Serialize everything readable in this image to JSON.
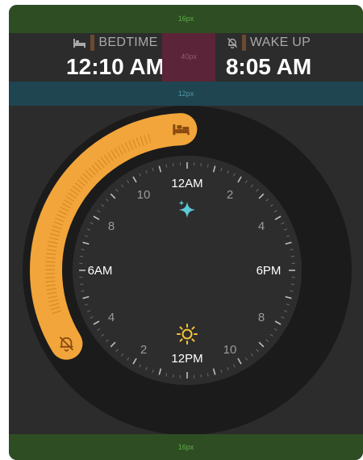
{
  "padding": {
    "top_label": "16px",
    "header_gap_label": "40px",
    "section_gap_label": "12px",
    "bottom_label": "16px"
  },
  "bedtime": {
    "label": "BEDTIME",
    "time": "12:10 AM",
    "icon": "bed-icon"
  },
  "wakeup": {
    "label": "WAKE UP",
    "time": "8:05 AM",
    "icon": "bell-slash-icon"
  },
  "dial": {
    "labels": {
      "top": "12AM",
      "left": "6AM",
      "right": "6PM",
      "bottom": "12PM"
    },
    "hour_numbers": [
      "2",
      "4",
      "8",
      "10",
      "2",
      "4",
      "8",
      "10"
    ],
    "start_hour": 0.1667,
    "end_hour": 8.0833,
    "colors": {
      "arc": "#f2a53a",
      "ring": "#1b1b1b",
      "face": "#2d2d2d",
      "sparkle": "#5bc9d6",
      "sun": "#f6c338"
    }
  }
}
